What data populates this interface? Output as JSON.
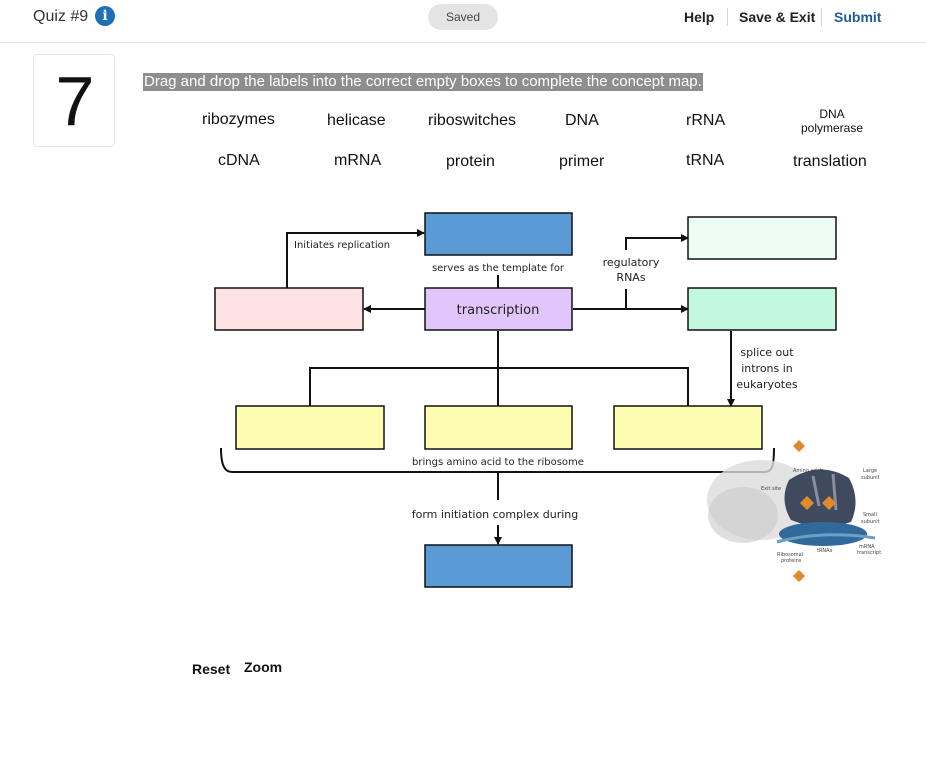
{
  "header": {
    "quiz_title": "Quiz #9",
    "status": "Saved",
    "help_label": "Help",
    "save_exit_label": "Save & Exit",
    "submit_label": "Submit"
  },
  "question": {
    "number": "7",
    "instructions": "Drag and drop the labels into the correct empty boxes to complete the concept map."
  },
  "labels": [
    "ribozymes",
    "helicase",
    "riboswitches",
    "DNA",
    "rRNA",
    "DNA polymerase",
    "cDNA",
    "mRNA",
    "protein",
    "primer",
    "tRNA",
    "translation"
  ],
  "diagram": {
    "center_box": "transcription",
    "edge_initiates": "Initiates replication",
    "edge_template": "serves as the template for",
    "edge_regulatory_line1": "regulatory",
    "edge_regulatory_line2": "RNAs",
    "edge_splice_line1": "splice out",
    "edge_splice_line2": "introns in",
    "edge_splice_line3": "eukaryotes",
    "edge_brings": "brings amino acid to the ribosome",
    "edge_form": "form initiation complex during",
    "ribosome_labels": {
      "amino_acids": "Amino acids",
      "large_subunit_1": "Large",
      "large_subunit_2": "subunit",
      "exit_site": "Exit site",
      "small_subunit_1": "Small",
      "small_subunit_2": "subunit",
      "ribosomal_proteins_1": "Ribosomal",
      "ribosomal_proteins_2": "proteins",
      "trnas": "tRNAs",
      "mrna_transcript_1": "mRNA",
      "mrna_transcript_2": "transcript"
    },
    "colors": {
      "blue": "#5b9bd5",
      "pink": "#fde1e3",
      "mint_light": "#eefcf6",
      "mint": "#c1f8df",
      "lavender": "#e2c5fb",
      "yellow": "#fdfdb2"
    }
  },
  "footer": {
    "reset_label": "Reset",
    "zoom_label": "Zoom"
  }
}
